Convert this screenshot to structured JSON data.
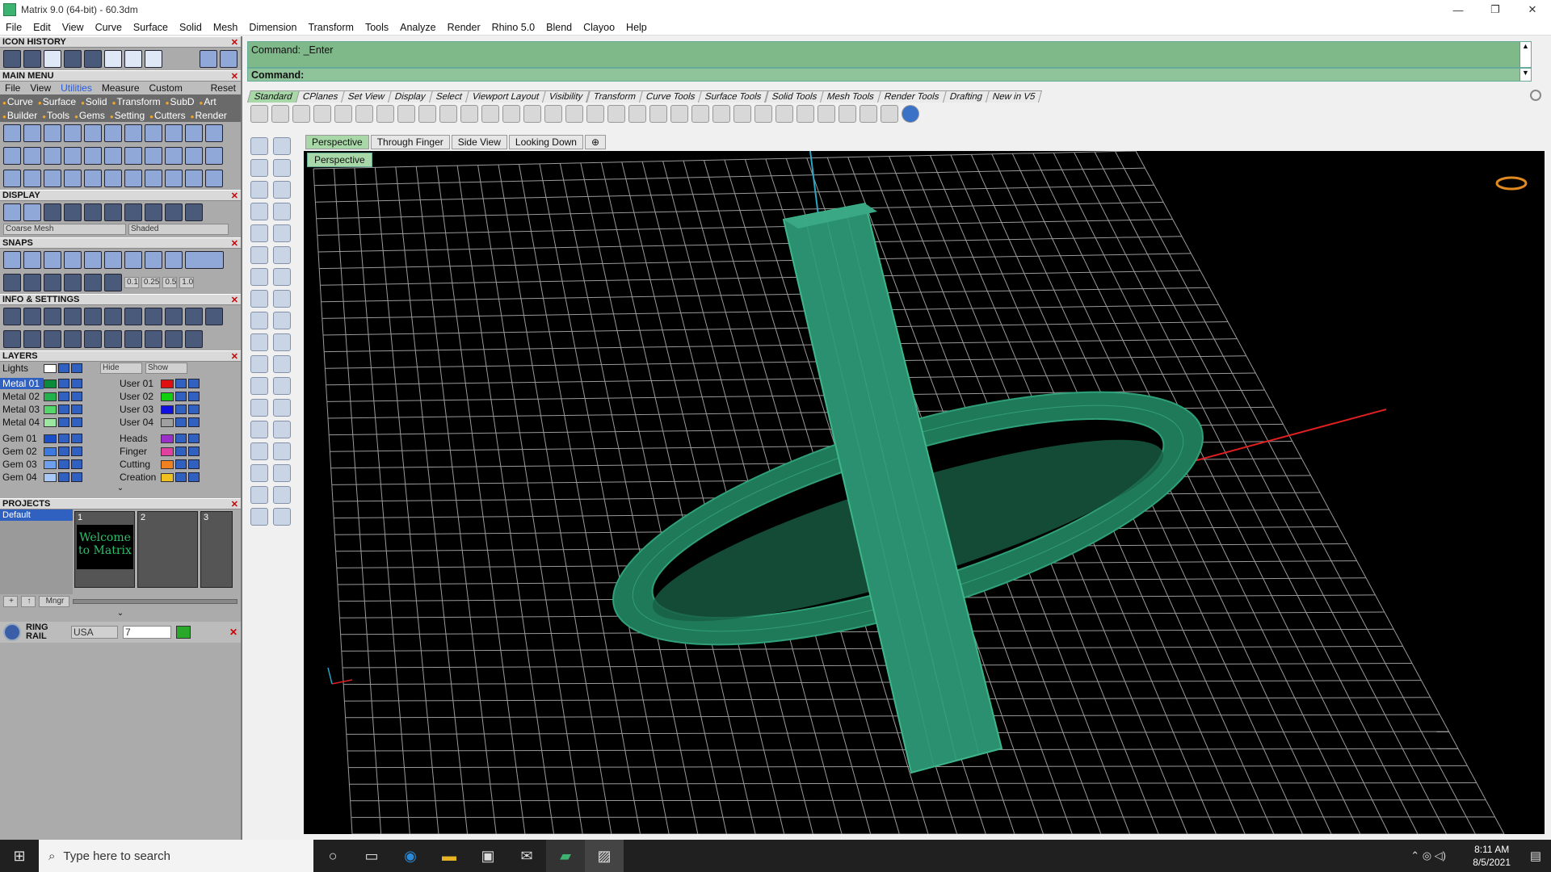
{
  "window": {
    "title": "Matrix 9.0 (64-bit) - 60.3dm",
    "min": "—",
    "max": "❐",
    "close": "✕"
  },
  "menubar": [
    "File",
    "Edit",
    "View",
    "Curve",
    "Surface",
    "Solid",
    "Mesh",
    "Dimension",
    "Transform",
    "Tools",
    "Analyze",
    "Render",
    "Rhino 5.0",
    "Blend",
    "Clayoo",
    "Help"
  ],
  "left": {
    "icon_history": "ICON HISTORY",
    "main_menu": "MAIN MENU",
    "mm_row": [
      "File",
      "View",
      "Utilities",
      "Measure",
      "Custom",
      "Reset"
    ],
    "mm_cats1": [
      "Curve",
      "Surface",
      "Solid",
      "Transform",
      "SubD",
      "Art"
    ],
    "mm_cats2": [
      "Builder",
      "Tools",
      "Gems",
      "Setting",
      "Cutters",
      "Render"
    ],
    "display": "DISPLAY",
    "display_mesh": "Coarse Mesh",
    "display_mode": "Shaded",
    "snaps": "SNAPS",
    "snap_vals": [
      "0.1",
      "0.25",
      "0.5",
      "1.0"
    ],
    "info": "INFO & SETTINGS",
    "layers": "LAYERS",
    "lights": "Lights",
    "hide": "Hide",
    "show": "Show",
    "layers_left": [
      "Metal 01",
      "Metal 02",
      "Metal 03",
      "Metal 04",
      "Gem 01",
      "Gem 02",
      "Gem 03",
      "Gem 04"
    ],
    "layers_right": [
      "User 01",
      "User 02",
      "User 03",
      "User 04",
      "Heads",
      "Finger",
      "Cutting",
      "Creation"
    ],
    "projects": "PROJECTS",
    "project_default": "Default",
    "project_nums": [
      "1",
      "2",
      "3"
    ],
    "welcome": "Welcome to Matrix",
    "mngr": "Mngr",
    "ring_rail": "RING RAIL",
    "ring_region": "USA",
    "ring_size": "7"
  },
  "command": {
    "line1": "Command: _Enter",
    "line2": "Command:"
  },
  "toolbar_tabs": [
    "Standard",
    "CPlanes",
    "Set View",
    "Display",
    "Select",
    "Viewport Layout",
    "Visibility",
    "Transform",
    "Curve Tools",
    "Surface Tools",
    "Solid Tools",
    "Mesh Tools",
    "Render Tools",
    "Drafting",
    "New in V5"
  ],
  "view_tabs": [
    "Perspective",
    "Through Finger",
    "Side View",
    "Looking Down"
  ],
  "viewport_label": "Perspective",
  "taskbar": {
    "search_placeholder": "Type here to search",
    "time": "8:11 AM",
    "date": "8/5/2021"
  }
}
